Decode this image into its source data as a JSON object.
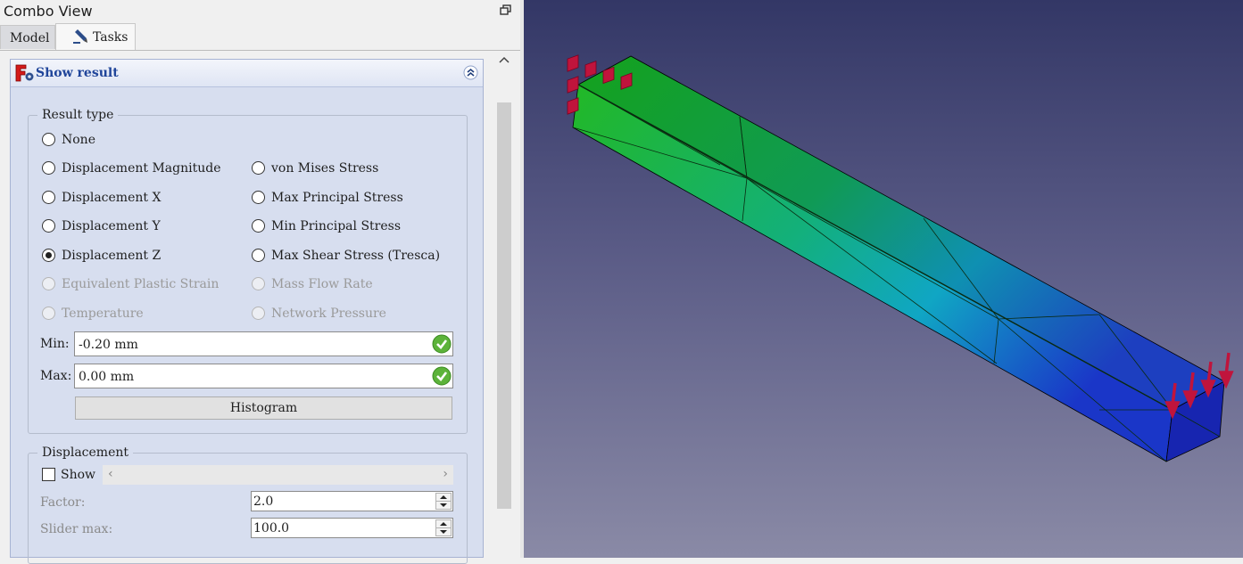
{
  "window": {
    "title": "Combo View"
  },
  "tabs": [
    {
      "label": "Model"
    },
    {
      "label": "Tasks"
    }
  ],
  "task": {
    "title": "Show result",
    "result_type": {
      "legend": "Result type",
      "left_options": [
        {
          "label": "None",
          "checked": false,
          "enabled": true
        },
        {
          "label": "Displacement Magnitude",
          "checked": false,
          "enabled": true
        },
        {
          "label": "Displacement X",
          "checked": false,
          "enabled": true
        },
        {
          "label": "Displacement Y",
          "checked": false,
          "enabled": true
        },
        {
          "label": "Displacement Z",
          "checked": true,
          "enabled": true
        },
        {
          "label": "Equivalent Plastic Strain",
          "checked": false,
          "enabled": false
        },
        {
          "label": "Temperature",
          "checked": false,
          "enabled": false
        }
      ],
      "right_options": [
        {
          "label": "von Mises Stress",
          "checked": false,
          "enabled": true
        },
        {
          "label": "Max Principal Stress",
          "checked": false,
          "enabled": true
        },
        {
          "label": "Min Principal Stress",
          "checked": false,
          "enabled": true
        },
        {
          "label": "Max Shear Stress (Tresca)",
          "checked": false,
          "enabled": true
        },
        {
          "label": "Mass Flow Rate",
          "checked": false,
          "enabled": false
        },
        {
          "label": "Network Pressure",
          "checked": false,
          "enabled": false
        }
      ],
      "min_label": "Min:",
      "min_value": "-0.20 mm",
      "max_label": "Max:",
      "max_value": "0.00 mm",
      "histogram_label": "Histogram"
    },
    "displacement": {
      "legend": "Displacement",
      "show_label": "Show",
      "show_checked": false,
      "factor_label": "Factor:",
      "factor_value": "2.0",
      "slider_max_label": "Slider max:",
      "slider_max_value": "100.0"
    }
  },
  "colors": {
    "task_bg": "#d7deef",
    "task_title": "#20459a",
    "mesh_fixed": "#10a020",
    "mesh_loaded": "#1a2cb8",
    "constraint_red": "#c0143c",
    "viewport_top": "#333766",
    "viewport_bottom": "#8a8aa6"
  },
  "icons": [
    "float-icon",
    "pencil-icon",
    "freecad-fem-icon",
    "collapse-icon",
    "checkmark-icon",
    "spin-arrows-icon"
  ]
}
